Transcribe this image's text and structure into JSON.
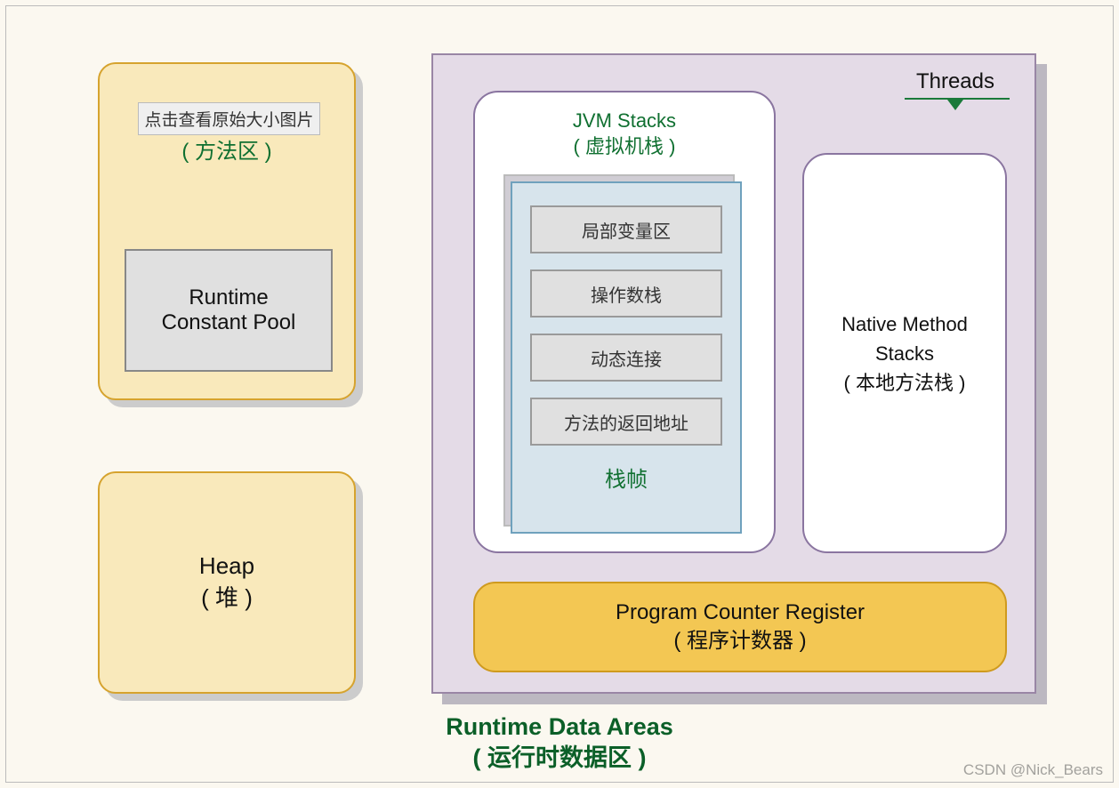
{
  "click_hint": "点击查看原始大小图片",
  "left": {
    "method_area_label": "( 方法区 )",
    "constant_pool": {
      "line1": "Runtime",
      "line2": "Constant Pool"
    },
    "heap": {
      "line1": "Heap",
      "line2": "( 堆 )"
    }
  },
  "threads": {
    "label": "Threads",
    "jvm_stacks": {
      "title_en": "JVM Stacks",
      "title_cn": "( 虚拟机栈 )"
    },
    "stack_frame": {
      "items": [
        "局部变量区",
        "操作数栈",
        "动态连接",
        "方法的返回地址"
      ],
      "label": "栈帧"
    },
    "native_stacks": {
      "line1": "Native Method",
      "line2": "Stacks",
      "line3": "( 本地方法栈 )"
    },
    "pc_register": {
      "line1": "Program Counter Register",
      "line2": "( 程序计数器 )"
    }
  },
  "main_title": {
    "line1": "Runtime Data Areas",
    "line2": "( 运行时数据区 )"
  },
  "watermark": "CSDN @Nick_Bears"
}
